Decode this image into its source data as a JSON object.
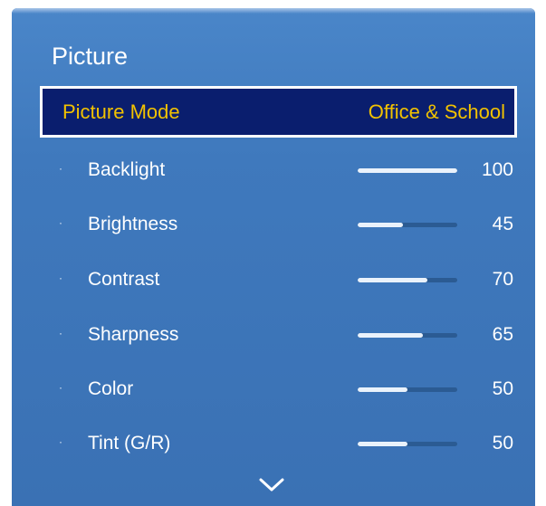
{
  "menu": {
    "title": "Picture",
    "picture_mode": {
      "label": "Picture Mode",
      "value": "Office & School"
    },
    "settings": [
      {
        "label": "Backlight",
        "value": "100",
        "level": 1.0
      },
      {
        "label": "Brightness",
        "value": "45",
        "level": 0.45
      },
      {
        "label": "Contrast",
        "value": "70",
        "level": 0.7
      },
      {
        "label": "Sharpness",
        "value": "65",
        "level": 0.65
      },
      {
        "label": "Color",
        "value": "50",
        "level": 0.5
      },
      {
        "label": "Tint (G/R)",
        "value": "50",
        "level": 0.5
      }
    ],
    "bullet": "·"
  },
  "icons": {
    "scroll_down": "chevron-down-icon"
  },
  "colors": {
    "panel": "#3f79bd",
    "selected_background": "#0a1e6e",
    "selected_text": "#f2c200",
    "slider_fill": "#eaf2fb",
    "slider_track": "#2b5b93"
  }
}
